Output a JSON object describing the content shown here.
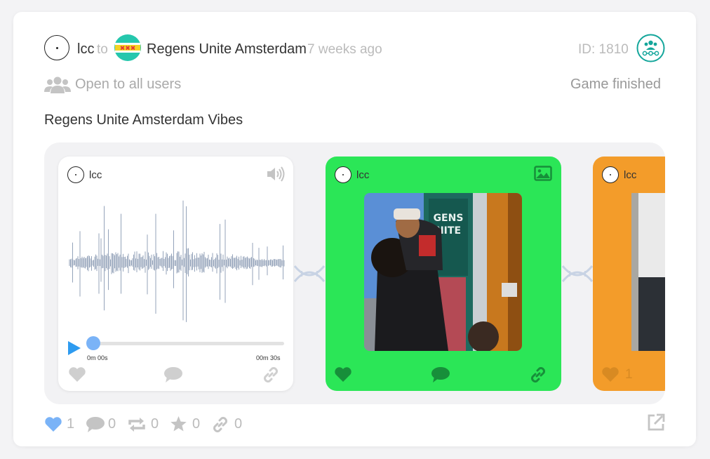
{
  "post": {
    "author": "lcc",
    "to_word": "to",
    "space_name": "Regens Unite Amsterdam",
    "time_ago": "7 weeks ago",
    "id_label": "ID: 1810",
    "access_label": "Open to all users",
    "status_label": "Game finished",
    "title": "Regens Unite Amsterdam Vibes"
  },
  "beads": [
    {
      "author": "lcc",
      "type_icon": "speaker-icon",
      "background": "#ffffff",
      "audio": {
        "current_time": "0m 00s",
        "duration": "00m 30s",
        "progress": 0
      }
    },
    {
      "author": "lcc",
      "type_icon": "image-icon",
      "background": "#2be657"
    },
    {
      "author": "lcc",
      "type_icon": "image-icon",
      "background": "#f39c2a",
      "like_count": "1"
    }
  ],
  "stats": {
    "likes": "1",
    "comments": "0",
    "reposts": "0",
    "ratings": "0",
    "links": "0"
  },
  "colors": {
    "accent_teal": "#14a69b",
    "like_blue": "#7ab3f7",
    "audio_blue": "#2e9bf0",
    "green_bead": "#2be657",
    "orange_bead": "#f39c2a",
    "gray_text": "#aaaaaa"
  },
  "icons": [
    "user-avatar-icon",
    "space-logo-icon",
    "game-icon",
    "users-icon",
    "speaker-icon",
    "play-icon",
    "image-icon",
    "dna-icon",
    "heart-icon",
    "comment-icon",
    "link-icon",
    "repost-icon",
    "star-icon",
    "external-link-icon"
  ]
}
